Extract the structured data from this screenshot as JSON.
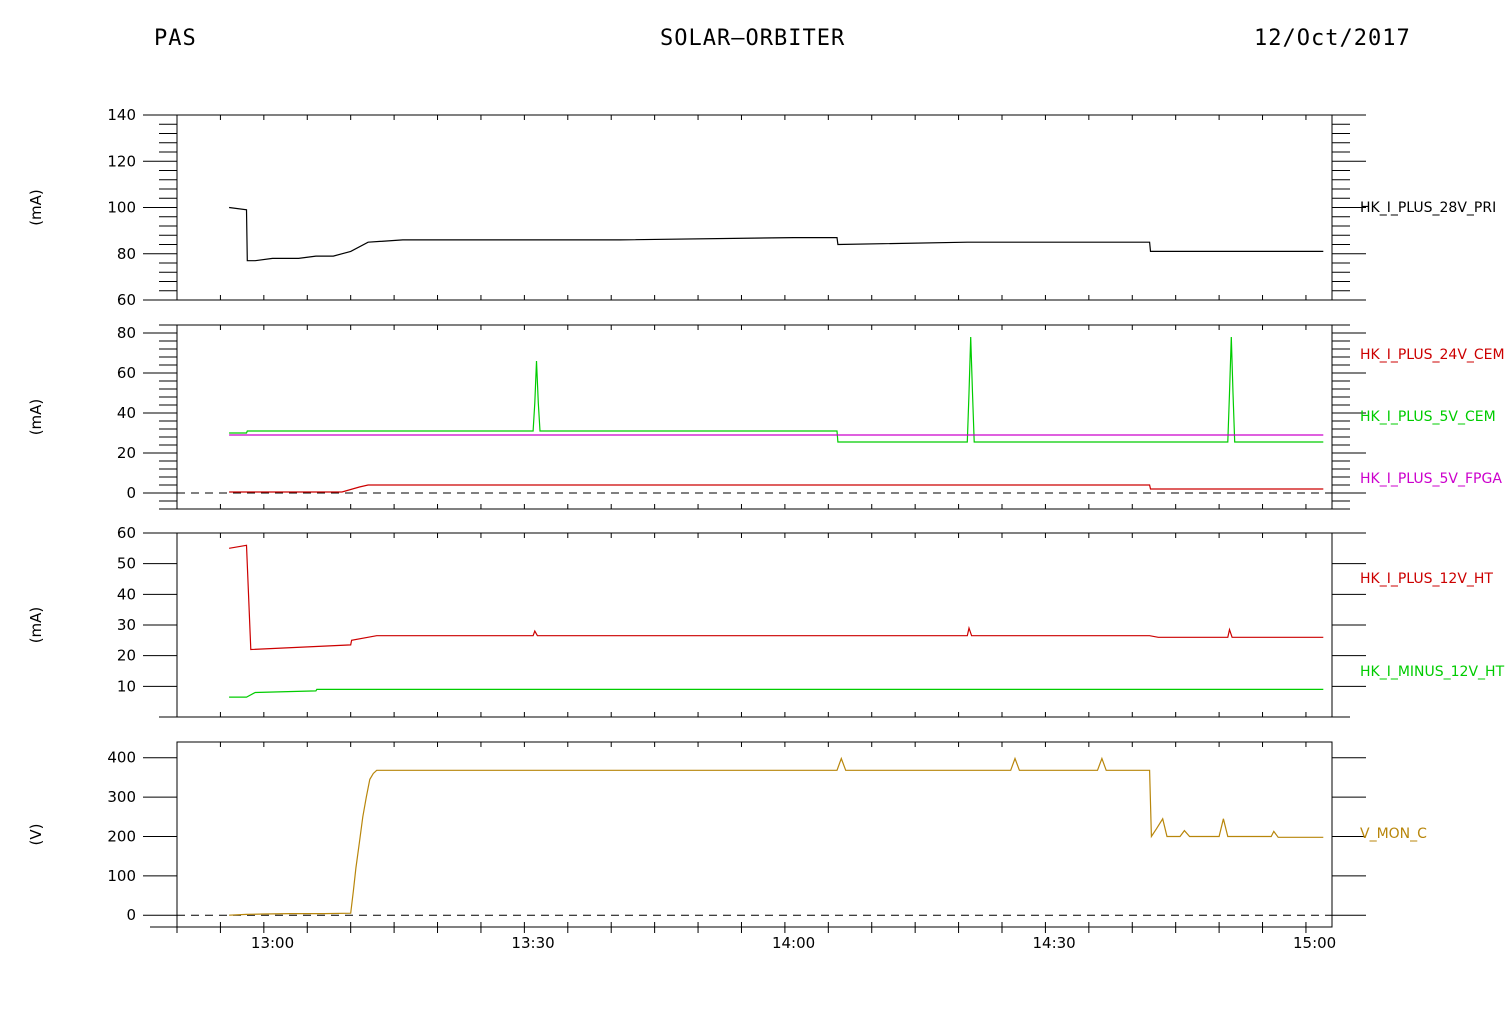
{
  "header": {
    "left": "PAS",
    "center": "SOLAR—ORBITER",
    "right": "12/Oct/2017"
  },
  "chart_data": [
    {
      "type": "line",
      "ylabel": "(mA)",
      "ylim": [
        60,
        140
      ],
      "yticks": [
        60,
        80,
        100,
        120,
        140
      ],
      "xlim": [
        "12:49",
        "15:02"
      ],
      "series": [
        {
          "name": "HK_I_PLUS_28V_PRI",
          "color": "#000000",
          "x": [
            "12:55",
            "12:57",
            "12:57.1",
            "12:58",
            "13:00",
            "13:03",
            "13:05",
            "13:07",
            "13:09",
            "13:11",
            "13:15",
            "13:30",
            "13:40",
            "14:00",
            "14:05",
            "14:05.1",
            "14:20",
            "14:41",
            "14:41.1",
            "14:50",
            "15:01"
          ],
          "y": [
            100,
            99,
            77,
            77,
            78,
            78,
            79,
            79,
            81,
            85,
            86,
            86,
            86,
            87,
            87,
            84,
            85,
            85,
            81,
            81,
            81
          ]
        }
      ]
    },
    {
      "type": "line",
      "ylabel": "(mA)",
      "ylim": [
        -8,
        84
      ],
      "yticks": [
        0,
        20,
        40,
        60,
        80
      ],
      "zero_line": true,
      "xlim": [
        "12:49",
        "15:02"
      ],
      "series": [
        {
          "name": "HK_I_PLUS_24V_CEM",
          "color": "#cc0000",
          "x": [
            "12:55",
            "13:08",
            "13:10",
            "13:11",
            "14:41",
            "14:41.1",
            "15:01"
          ],
          "y": [
            0.5,
            0.5,
            3,
            4,
            4,
            2,
            2
          ]
        },
        {
          "name": "HK_I_PLUS_5V_CEM",
          "color": "#00cc00",
          "x": [
            "12:55",
            "12:57",
            "12:57.1",
            "13:30",
            "13:30.2",
            "13:30.4",
            "13:30.6",
            "13:30.8",
            "14:05",
            "14:05.1",
            "14:20",
            "14:20.2",
            "14:20.4",
            "14:20.6",
            "14:20.8",
            "14:50",
            "14:50.2",
            "14:50.4",
            "14:50.6",
            "14:50.8",
            "15:01"
          ],
          "y": [
            30,
            30,
            31,
            31,
            45,
            66,
            45,
            31,
            31,
            25.5,
            25.5,
            50,
            78,
            50,
            25.5,
            25.5,
            50,
            78,
            50,
            25.5,
            25.5
          ]
        },
        {
          "name": "HK_I_PLUS_5V_FPGA",
          "color": "#cc00cc",
          "x": [
            "12:55",
            "15:01"
          ],
          "y": [
            29,
            29
          ]
        }
      ]
    },
    {
      "type": "line",
      "ylabel": "(mA)",
      "ylim": [
        0,
        60
      ],
      "yticks": [
        10,
        20,
        30,
        40,
        50,
        60
      ],
      "xlim": [
        "12:49",
        "15:02"
      ],
      "series": [
        {
          "name": "HK_I_PLUS_12V_HT",
          "color": "#cc0000",
          "x": [
            "12:55",
            "12:57",
            "12:57.5",
            "13:05",
            "13:09",
            "13:09.1",
            "13:12",
            "13:30",
            "13:30.2",
            "13:30.5",
            "14:20",
            "14:20.2",
            "14:20.5",
            "14:41",
            "14:42",
            "14:50",
            "14:50.2",
            "14:50.5",
            "15:01"
          ],
          "y": [
            55,
            56,
            22,
            23,
            23.5,
            25,
            26.5,
            26.5,
            28,
            26.5,
            26.5,
            29,
            26.5,
            26.5,
            26,
            26,
            28.5,
            26,
            26
          ]
        },
        {
          "name": "HK_I_MINUS_12V_HT",
          "color": "#00cc00",
          "x": [
            "12:55",
            "12:57",
            "12:58",
            "13:05",
            "13:05.1",
            "15:01"
          ],
          "y": [
            6.5,
            6.5,
            8,
            8.5,
            9,
            9
          ]
        }
      ]
    },
    {
      "type": "line",
      "ylabel": "(V)",
      "ylim": [
        -30,
        440
      ],
      "yticks": [
        0,
        100,
        200,
        300,
        400
      ],
      "zero_line": true,
      "xlim": [
        "12:49",
        "15:02"
      ],
      "series": [
        {
          "name": "V_MON_C",
          "color": "#b8860b",
          "x": [
            "12:55",
            "12:57",
            "12:59",
            "13:02",
            "13:06",
            "13:09",
            "13:09.3",
            "13:09.6",
            "13:10",
            "13:10.4",
            "13:10.8",
            "13:11.2",
            "13:11.6",
            "13:12",
            "13:12.5",
            "14:05",
            "14:05.5",
            "14:06",
            "14:25",
            "14:25.5",
            "14:26",
            "14:35",
            "14:35.5",
            "14:36",
            "14:41",
            "14:41.2",
            "14:41.8",
            "14:42.5",
            "14:43",
            "14:44.5",
            "14:45",
            "14:45.6",
            "14:49",
            "14:49.5",
            "14:50",
            "14:55",
            "14:55.3",
            "14:55.8",
            "15:01"
          ],
          "y": [
            0,
            2,
            3,
            4,
            4,
            5,
            60,
            120,
            185,
            250,
            300,
            345,
            360,
            368,
            368,
            368,
            398,
            368,
            368,
            398,
            368,
            368,
            398,
            368,
            368,
            200,
            220,
            245,
            200,
            200,
            215,
            200,
            200,
            245,
            200,
            200,
            213,
            198,
            198
          ]
        }
      ]
    }
  ],
  "x_axis": {
    "tick_labels": [
      "13:00",
      "13:30",
      "14:00",
      "14:30",
      "15:00"
    ]
  }
}
